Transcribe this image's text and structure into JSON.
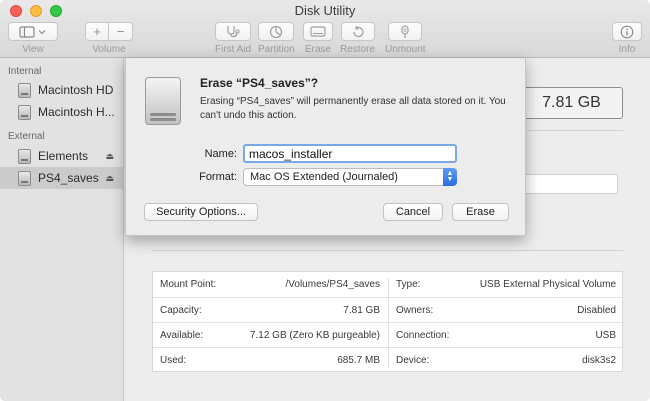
{
  "window": {
    "title": "Disk Utility"
  },
  "toolbar": {
    "view_label": "View",
    "volume_label": "Volume",
    "first_aid_label": "First Aid",
    "partition_label": "Partition",
    "erase_label": "Erase",
    "restore_label": "Restore",
    "unmount_label": "Unmount",
    "info_label": "Info"
  },
  "sidebar": {
    "internal_heading": "Internal",
    "external_heading": "External",
    "internal_items": [
      {
        "label": "Macintosh HD"
      },
      {
        "label": "Macintosh H..."
      }
    ],
    "external_items": [
      {
        "label": "Elements"
      },
      {
        "label": "PS4_saves",
        "selected": true
      }
    ]
  },
  "volume": {
    "capacity_display": "7.81 GB"
  },
  "dialog": {
    "title": "Erase “PS4_saves”?",
    "message": "Erasing “PS4_saves” will permanently erase all data stored on it. You can't undo this action.",
    "name_label": "Name:",
    "name_value": "macos_installer",
    "format_label": "Format:",
    "format_value": "Mac OS Extended (Journaled)",
    "security_button": "Security Options...",
    "cancel_button": "Cancel",
    "erase_button": "Erase"
  },
  "info": {
    "left": [
      {
        "label": "Mount Point:",
        "value": "/Volumes/PS4_saves"
      },
      {
        "label": "Capacity:",
        "value": "7.81 GB"
      },
      {
        "label": "Available:",
        "value": "7.12 GB (Zero KB purgeable)"
      },
      {
        "label": "Used:",
        "value": "685.7 MB"
      }
    ],
    "right": [
      {
        "label": "Type:",
        "value": "USB External Physical Volume"
      },
      {
        "label": "Owners:",
        "value": "Disabled"
      },
      {
        "label": "Connection:",
        "value": "USB"
      },
      {
        "label": "Device:",
        "value": "disk3s2"
      }
    ]
  },
  "colors": {
    "accent": "#2a6fe0",
    "focus_ring": "#7aa7e8"
  }
}
